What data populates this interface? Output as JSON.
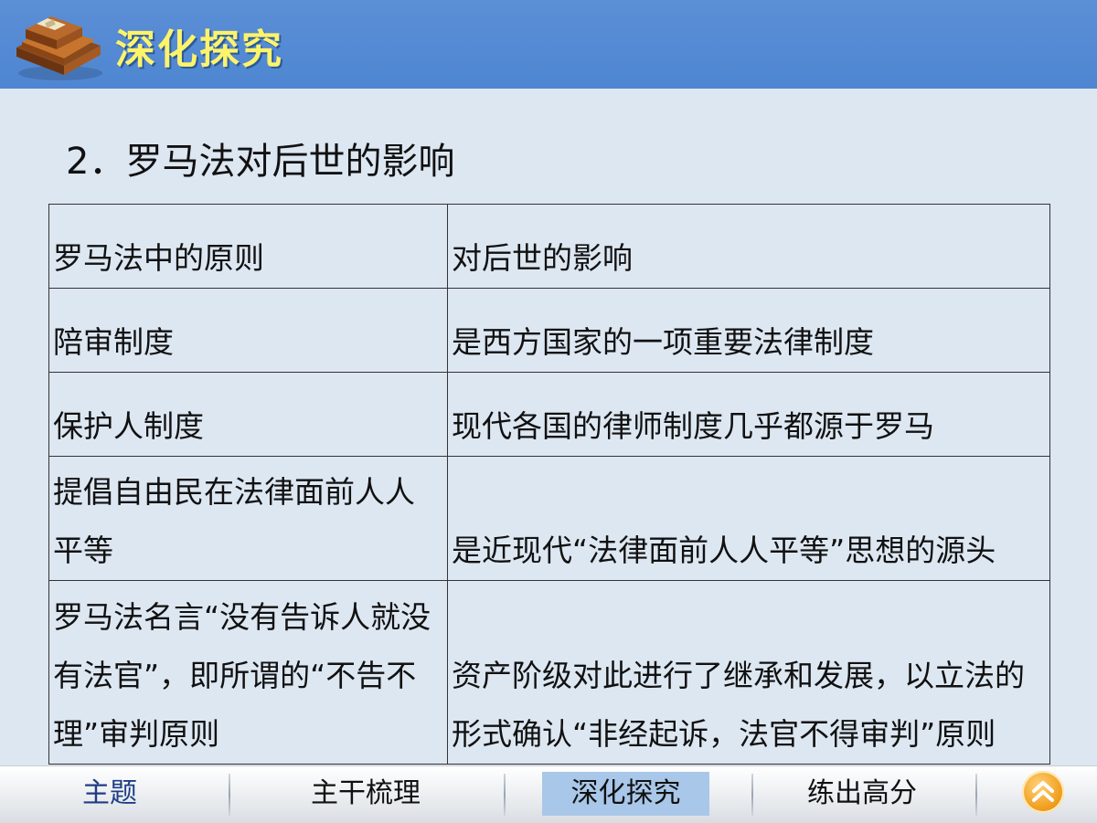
{
  "header": {
    "title": "深化探究"
  },
  "section": {
    "heading": "2．罗马法对后世的影响"
  },
  "table": {
    "headers": [
      "罗马法中的原则",
      "对后世的影响"
    ],
    "rows": [
      [
        "陪审制度",
        "是西方国家的一项重要法律制度"
      ],
      [
        "保护人制度",
        "现代各国的律师制度几乎都源于罗马"
      ],
      [
        "提倡自由民在法律面前人人平等",
        "是近现代“法律面前人人平等”思想的源头"
      ],
      [
        "罗马法名言“没有告诉人就没有法官”，即所谓的“不告不理”审判原则",
        "资产阶级对此进行了继承和发展，以立法的形式确认“非经起诉，法官不得审判”原则"
      ]
    ]
  },
  "nav": {
    "items": [
      "主题",
      "主干梳理",
      "深化探究",
      "练出高分"
    ],
    "active": "深化探究"
  },
  "colors": {
    "header_bg": "#4f86d1",
    "title_text": "#fff36a",
    "page_bg": "#dde7f2",
    "nav_active_bg": "#a9c7e8",
    "up_button": "#f1a020"
  },
  "icons": {
    "header": "book-icon",
    "nav_up": "up-arrow-icon"
  }
}
